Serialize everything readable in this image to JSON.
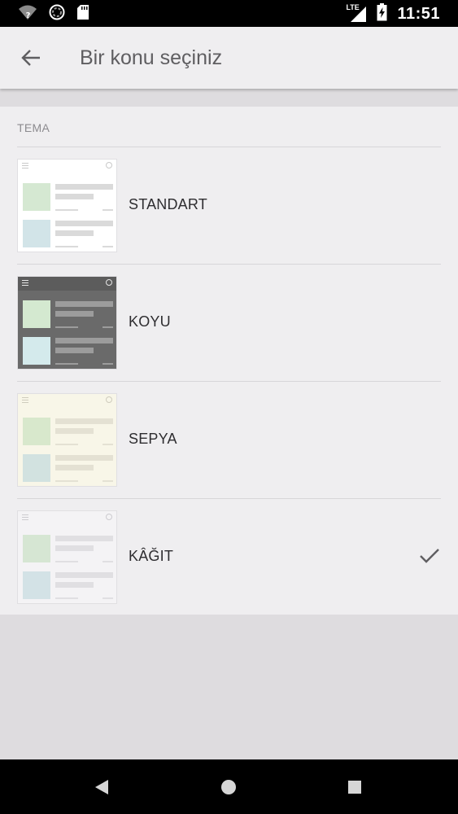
{
  "status_bar": {
    "time": "11:51",
    "network": "LTE",
    "icons": [
      "wifi-unknown-icon",
      "sync-icon",
      "sd-card-icon",
      "lte-signal-icon",
      "battery-charging-icon"
    ]
  },
  "app_bar": {
    "title": "Bir konu seçiniz",
    "back_icon": "arrow-back-icon"
  },
  "section": {
    "label": "TEMA"
  },
  "themes": [
    {
      "label": "STANDART",
      "selected": false,
      "colors": {
        "bg": "#ffffff",
        "head": "#ffffff",
        "icon": "#c9c9c9",
        "line": "#dadada",
        "img1": "#d5e8d2",
        "img2": "#d2e4e8"
      }
    },
    {
      "label": "KOYU",
      "selected": false,
      "colors": {
        "bg": "#6a6a6a",
        "head": "#5c5c5c",
        "icon": "#e6e6e6",
        "line": "#9c9c9c",
        "img1": "#d4e9d0",
        "img2": "#d4eaec"
      }
    },
    {
      "label": "SEPYA",
      "selected": false,
      "colors": {
        "bg": "#f8f6e8",
        "head": "#f8f6e8",
        "icon": "#cfccbd",
        "line": "#e4e1d3",
        "img1": "#d8e8cc",
        "img2": "#d2e2e0"
      }
    },
    {
      "label": "KÂĞIT",
      "selected": true,
      "colors": {
        "bg": "#f4f3f5",
        "head": "#f4f3f5",
        "icon": "#cccbcf",
        "line": "#e0dfe2",
        "img1": "#d6e6d3",
        "img2": "#d3e2e6"
      }
    }
  ],
  "selected_icon": "checkmark-icon",
  "nav_bar": {
    "icons": [
      "back-triangle-icon",
      "home-circle-icon",
      "recents-square-icon"
    ]
  }
}
